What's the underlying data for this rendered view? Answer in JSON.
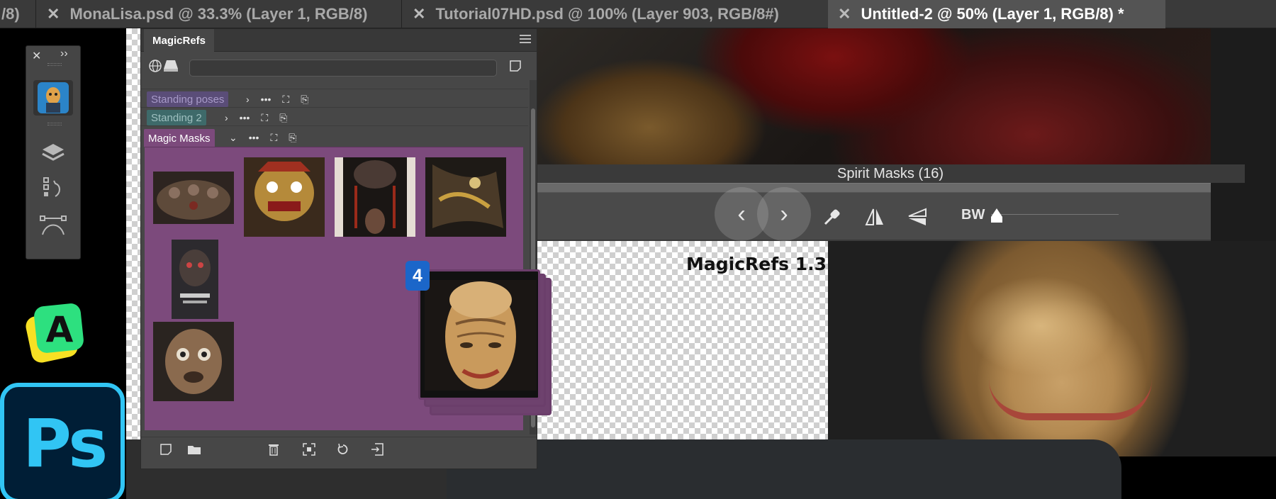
{
  "tabs": [
    {
      "label": "/8)",
      "close": false,
      "active": false
    },
    {
      "label": "MonaLisa.psd @ 33.3% (Layer 1, RGB/8)",
      "close": true,
      "active": false
    },
    {
      "label": "Tutorial07HD.psd @ 100% (Layer 903, RGB/8#)",
      "close": true,
      "active": false
    },
    {
      "label": "Untitled-2 @ 50% (Layer 1, RGB/8) *",
      "close": true,
      "active": true
    }
  ],
  "toolbar": {
    "close_glyph": "✕",
    "collapse_glyph": "››",
    "tools": [
      "avatar-icon",
      "layers-icon",
      "history-icon",
      "pen-path-icon"
    ]
  },
  "panel": {
    "title": "MagicRefs",
    "search_placeholder": "",
    "collections": [
      {
        "name": "Standing poses",
        "expanded": false,
        "color": "#5a4d78",
        "text": "#a79ac8"
      },
      {
        "name": "Standing 2",
        "expanded": false,
        "color": "#3e6a6a",
        "text": "#9fc0c0"
      },
      {
        "name": "Magic Masks",
        "expanded": true,
        "color": "#7c4a7c",
        "text": "#ffffff"
      }
    ],
    "drag_count": "4",
    "accent": "#7c4a7c"
  },
  "viewer": {
    "title": "Spirit Masks (16)",
    "bw_label": "BW",
    "prev_glyph": "‹",
    "next_glyph": "›"
  },
  "canvas": {
    "text": "MagicRefs 1.3"
  },
  "apps": {
    "ps_label": "Ps",
    "a_label": "A"
  },
  "colors": {
    "ps_blue": "#31c5f4",
    "ps_bg": "#001e36",
    "badge_blue": "#1b66c9"
  }
}
